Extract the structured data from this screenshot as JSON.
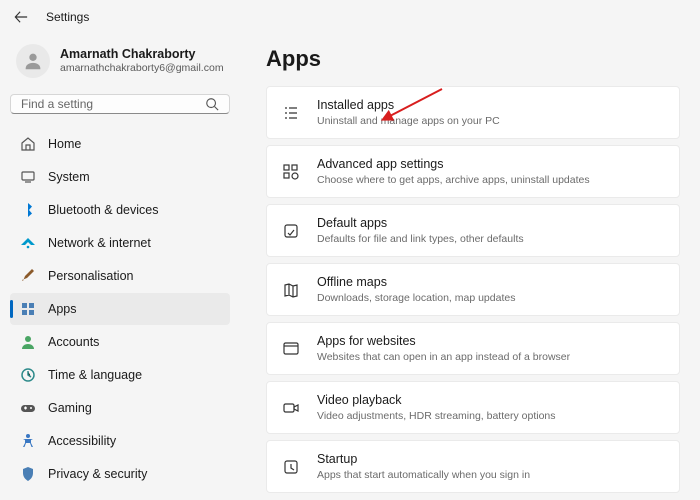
{
  "titlebar": {
    "title": "Settings"
  },
  "profile": {
    "name": "Amarnath Chakraborty",
    "email": "amarnathchakraborty6@gmail.com"
  },
  "search": {
    "placeholder": "Find a setting"
  },
  "nav": [
    {
      "icon": "home",
      "label": "Home"
    },
    {
      "icon": "system",
      "label": "System"
    },
    {
      "icon": "bluetooth",
      "label": "Bluetooth & devices"
    },
    {
      "icon": "wifi",
      "label": "Network & internet"
    },
    {
      "icon": "brush",
      "label": "Personalisation"
    },
    {
      "icon": "apps",
      "label": "Apps"
    },
    {
      "icon": "account",
      "label": "Accounts"
    },
    {
      "icon": "time",
      "label": "Time & language"
    },
    {
      "icon": "gaming",
      "label": "Gaming"
    },
    {
      "icon": "access",
      "label": "Accessibility"
    },
    {
      "icon": "privacy",
      "label": "Privacy & security"
    }
  ],
  "nav_selected": 5,
  "page": {
    "title": "Apps"
  },
  "cards": [
    {
      "icon": "list",
      "title": "Installed apps",
      "sub": "Uninstall and manage apps on your PC"
    },
    {
      "icon": "advanced",
      "title": "Advanced app settings",
      "sub": "Choose where to get apps, archive apps, uninstall updates"
    },
    {
      "icon": "default",
      "title": "Default apps",
      "sub": "Defaults for file and link types, other defaults"
    },
    {
      "icon": "maps",
      "title": "Offline maps",
      "sub": "Downloads, storage location, map updates"
    },
    {
      "icon": "websites",
      "title": "Apps for websites",
      "sub": "Websites that can open in an app instead of a browser"
    },
    {
      "icon": "video",
      "title": "Video playback",
      "sub": "Video adjustments, HDR streaming, battery options"
    },
    {
      "icon": "startup",
      "title": "Startup",
      "sub": "Apps that start automatically when you sign in"
    }
  ],
  "annotation": {
    "arrow_color": "#d81e1e"
  }
}
